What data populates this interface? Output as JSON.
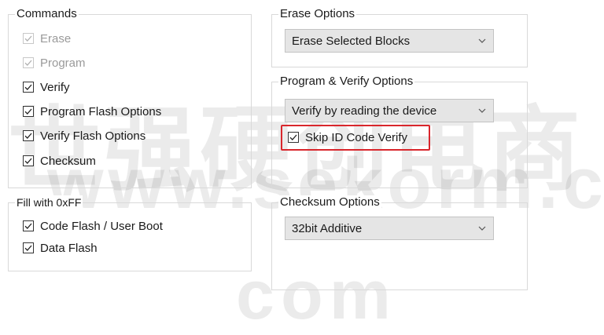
{
  "commands": {
    "legend": "Commands",
    "items": [
      {
        "label": "Erase",
        "checked": true,
        "enabled": false
      },
      {
        "label": "Program",
        "checked": true,
        "enabled": false
      },
      {
        "label": "Verify",
        "checked": true,
        "enabled": true
      },
      {
        "label": "Program Flash Options",
        "checked": true,
        "enabled": true
      },
      {
        "label": "Verify Flash Options",
        "checked": true,
        "enabled": true
      },
      {
        "label": "Checksum",
        "checked": true,
        "enabled": true
      }
    ]
  },
  "fill": {
    "legend": "Fill with 0xFF",
    "items": [
      {
        "label": "Code Flash / User Boot",
        "checked": true
      },
      {
        "label": "Data Flash",
        "checked": true
      }
    ]
  },
  "erase_options": {
    "legend": "Erase Options",
    "selected": "Erase Selected Blocks"
  },
  "program_verify_options": {
    "legend": "Program & Verify Options",
    "selected": "Verify by reading the device",
    "skip_id": {
      "label": "Skip ID Code Verify",
      "checked": true,
      "highlight_color": "#d9262c"
    }
  },
  "checksum_options": {
    "legend": "Checksum Options",
    "selected": "32bit Additive"
  },
  "watermark": {
    "line1": "世强硬创电商",
    "line2": "www.sekorm.com",
    "line3": "com"
  }
}
